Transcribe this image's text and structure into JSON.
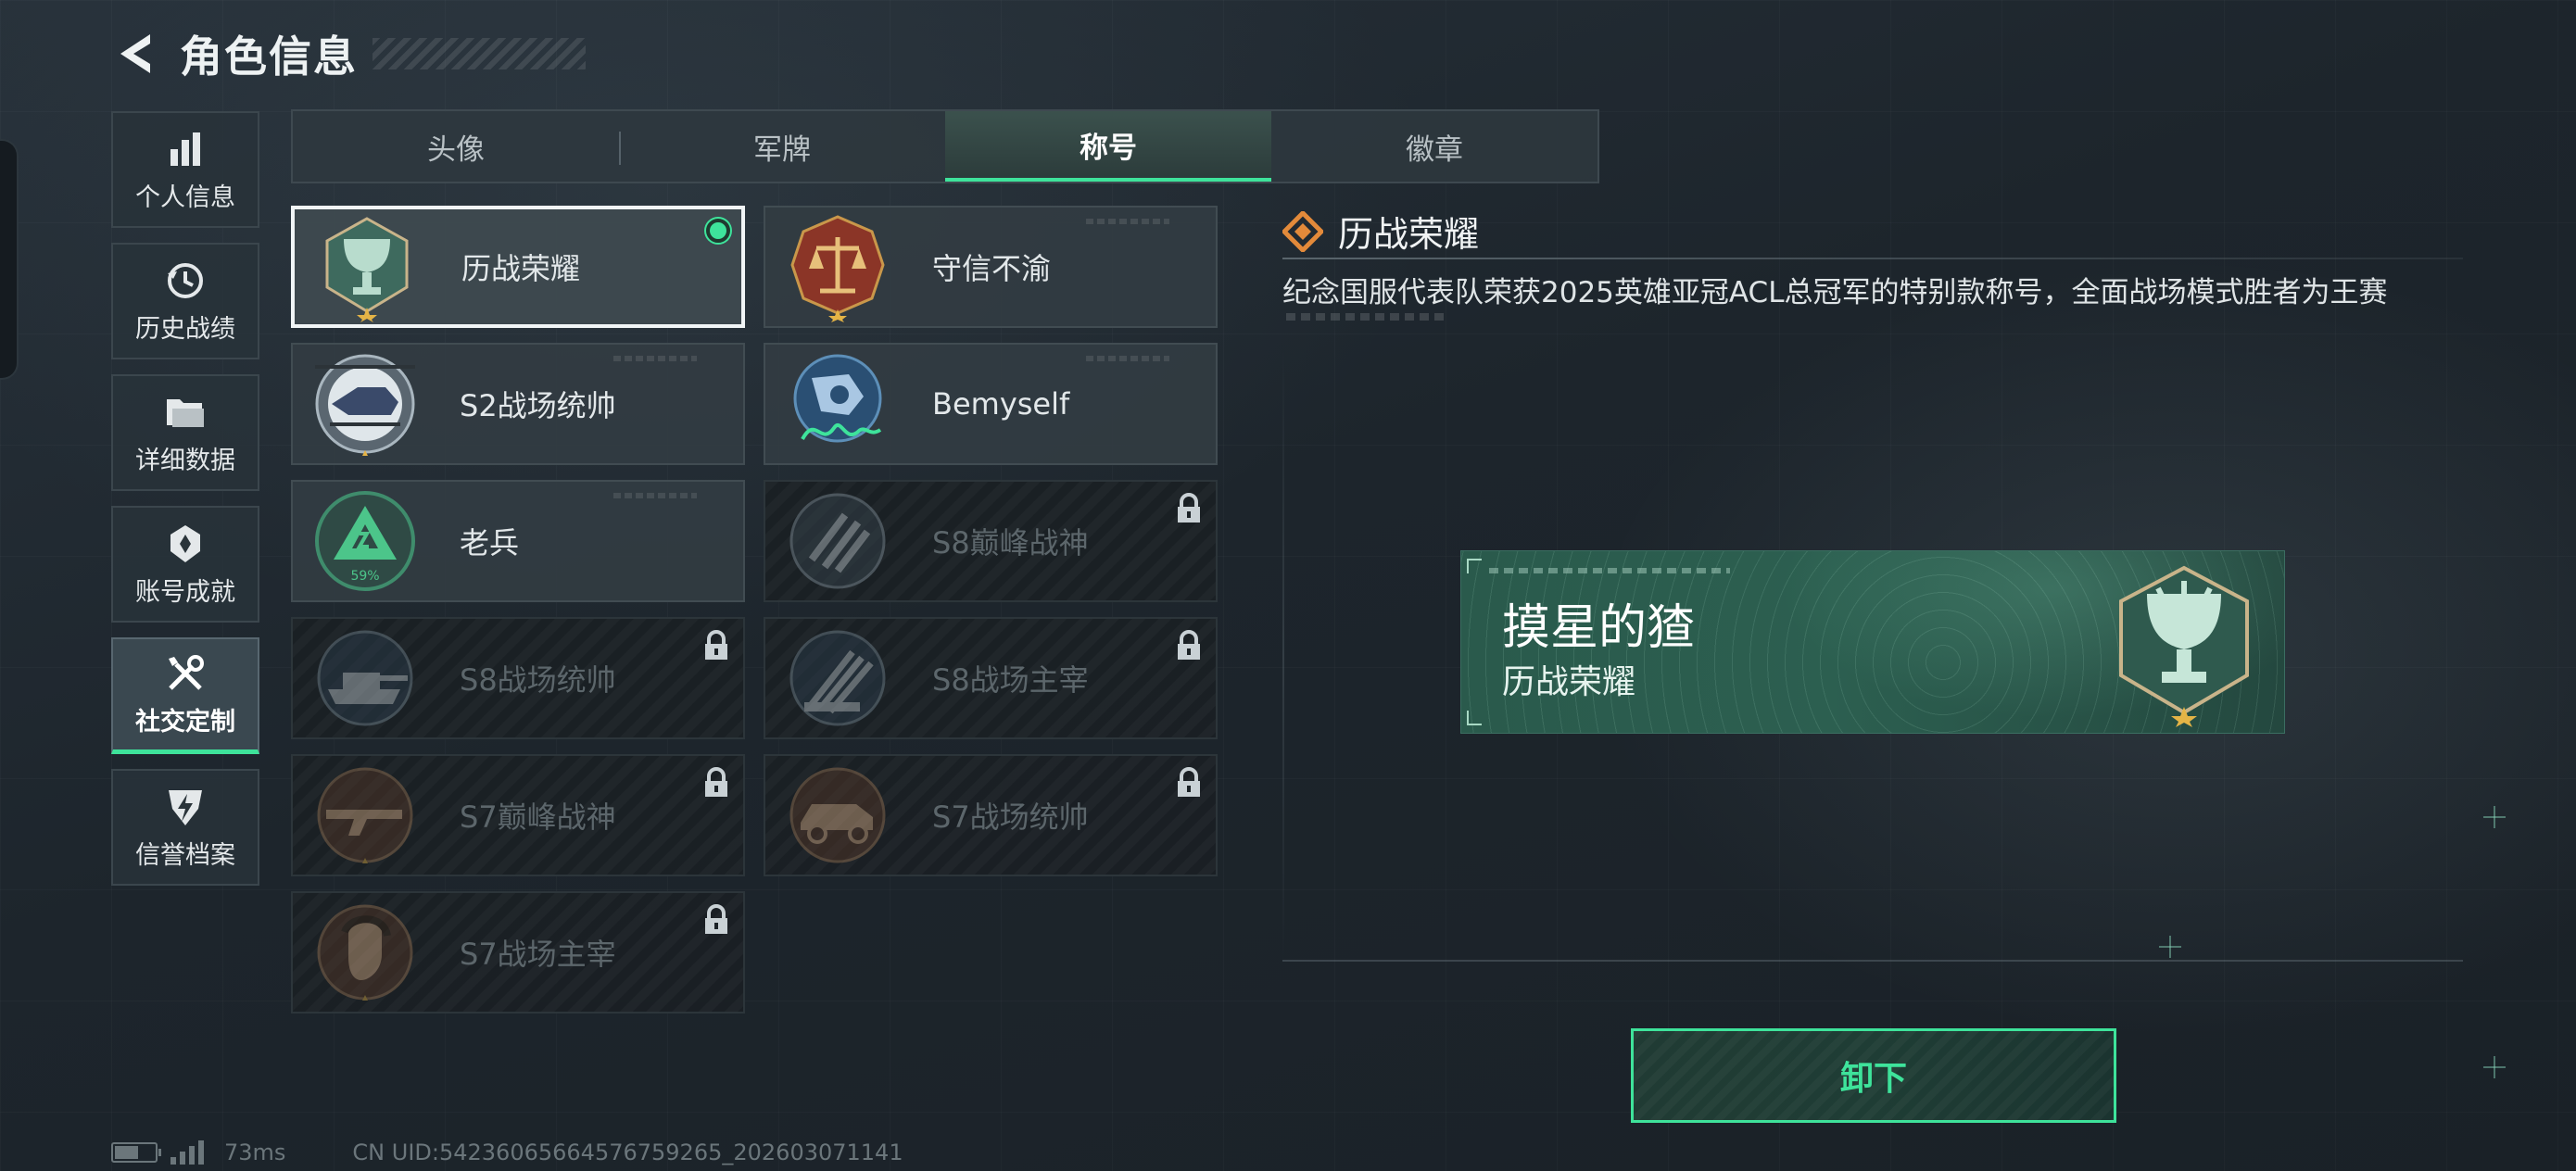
{
  "header": {
    "title": "角色信息",
    "back_icon": "back-arrow-icon"
  },
  "nav": {
    "items": [
      {
        "label": "个人信息",
        "icon": "bar-chart-icon"
      },
      {
        "label": "历史战绩",
        "icon": "history-clock-icon"
      },
      {
        "label": "详细数据",
        "icon": "folder-icon"
      },
      {
        "label": "账号成就",
        "icon": "achievement-badge-icon"
      },
      {
        "label": "社交定制",
        "icon": "tools-icon"
      },
      {
        "label": "信誉档案",
        "icon": "credit-shield-icon"
      }
    ],
    "active_index": 4
  },
  "tabs": {
    "items": [
      "头像",
      "军牌",
      "称号",
      "徽章"
    ],
    "active_index": 2
  },
  "titles": {
    "items": [
      {
        "name": "历战荣耀",
        "emblem": "trophy-emblem-icon",
        "locked": false,
        "selected": true,
        "equipped": true
      },
      {
        "name": "守信不渝",
        "emblem": "scales-emblem-icon",
        "locked": false
      },
      {
        "name": "S2战场统帅",
        "emblem": "helicopter-emblem-icon",
        "locked": false
      },
      {
        "name": "Bemyself",
        "emblem": "signature-emblem-icon",
        "locked": false
      },
      {
        "name": "老兵",
        "emblem": "veteran-emblem-icon",
        "locked": false,
        "progress_text": "59%"
      },
      {
        "name": "S8巅峰战神",
        "emblem": "stripes-emblem-icon",
        "locked": true
      },
      {
        "name": "S8战场统帅",
        "emblem": "tank-emblem-icon",
        "locked": true
      },
      {
        "name": "S8战场主宰",
        "emblem": "rocket-emblem-icon",
        "locked": true
      },
      {
        "name": "S7巅峰战神",
        "emblem": "rifle-emblem-icon",
        "locked": true
      },
      {
        "name": "S7战场统帅",
        "emblem": "vehicle-emblem-icon",
        "locked": true
      },
      {
        "name": "S7战场主宰",
        "emblem": "soldier-emblem-icon",
        "locked": true
      }
    ]
  },
  "detail": {
    "title": "历战荣耀",
    "description": "纪念国服代表队荣获2025英雄亚冠ACL总冠军的特别款称号，全面战场模式胜者为王赛"
  },
  "preview": {
    "player_name": "摸星的猹",
    "title": "历战荣耀"
  },
  "actions": {
    "unequip_label": "卸下"
  },
  "status": {
    "ping": "73ms",
    "uid": "CN UID:54236065664576759265_202603071141"
  },
  "colors": {
    "accent": "#3ee39b",
    "panel": "#323c42",
    "bg": "#1d252c"
  }
}
